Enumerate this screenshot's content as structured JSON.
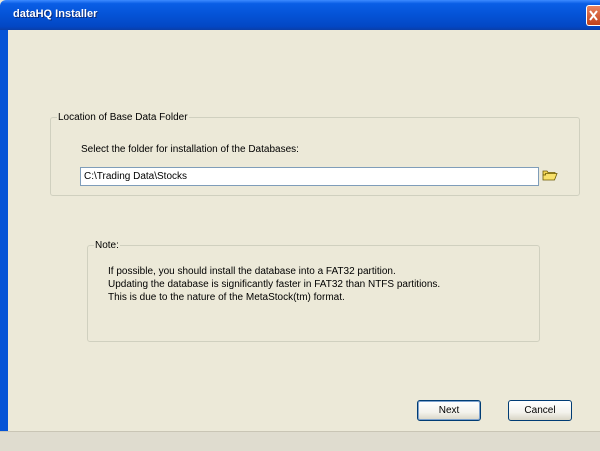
{
  "window": {
    "title": "dataHQ Installer"
  },
  "location_group": {
    "legend": "Location of Base Data Folder",
    "prompt": "Select the folder for installation of the Databases:",
    "path_value": "C:\\Trading Data\\Stocks",
    "browse_icon": "folder-open-icon"
  },
  "note_group": {
    "legend": "Note:",
    "lines": [
      "If possible, you should install the database into a FAT32 partition.",
      "Updating the database is significantly faster in FAT32 than NTFS partitions.",
      "This is due to the nature of the MetaStock(tm) format."
    ]
  },
  "buttons": {
    "next_label": "Next",
    "cancel_label": "Cancel"
  },
  "colors": {
    "titlebar": "#0453d6",
    "close_button": "#d6532a",
    "window_background": "#ece9d8"
  }
}
